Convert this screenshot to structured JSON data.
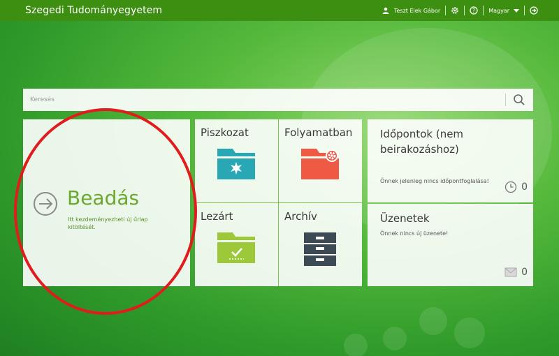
{
  "header": {
    "brand": "Szegedi Tudományegyetem",
    "user_name": "Teszt Elek Gábor",
    "language": "Magyar"
  },
  "search": {
    "placeholder": "Keresés"
  },
  "tiles": {
    "beadas": {
      "title": "Beadás",
      "description": "Itt kezdeményezheti új űrlap kitöltését."
    },
    "piszkozat": {
      "title": "Piszkozat"
    },
    "folyamatban": {
      "title": "Folyamatban"
    },
    "lezart": {
      "title": "Lezárt"
    },
    "archiv": {
      "title": "Archív"
    },
    "idopontok": {
      "title": "Időpontok (nem beirakozáshoz)",
      "message": "Önnek jelenleg nincs időpontfoglalása!",
      "count": "0"
    },
    "uzenetek": {
      "title": "Üzenetek",
      "message": "Önnek nincs új üzenete!",
      "count": "0"
    }
  },
  "colors": {
    "topbar": "#3d8f12",
    "accent_green": "#6aa92e",
    "teal": "#2aa7b5",
    "orange_red": "#ef5a45",
    "lime": "#9cc83a",
    "dark_slate": "#3c4a55",
    "annotation_red": "#e01c1c"
  },
  "icons": {
    "user": "user-icon",
    "settings": "gear-icon",
    "help": "help-icon",
    "logout": "logout-icon",
    "search": "search-icon",
    "beadas": "arrow-right-circle-icon",
    "piszkozat": "folder-star-icon",
    "folyamatban": "folder-gear-icon",
    "lezart": "folder-check-icon",
    "archiv": "cabinet-icon",
    "idopontok": "clock-icon",
    "uzenetek": "envelope-icon"
  }
}
